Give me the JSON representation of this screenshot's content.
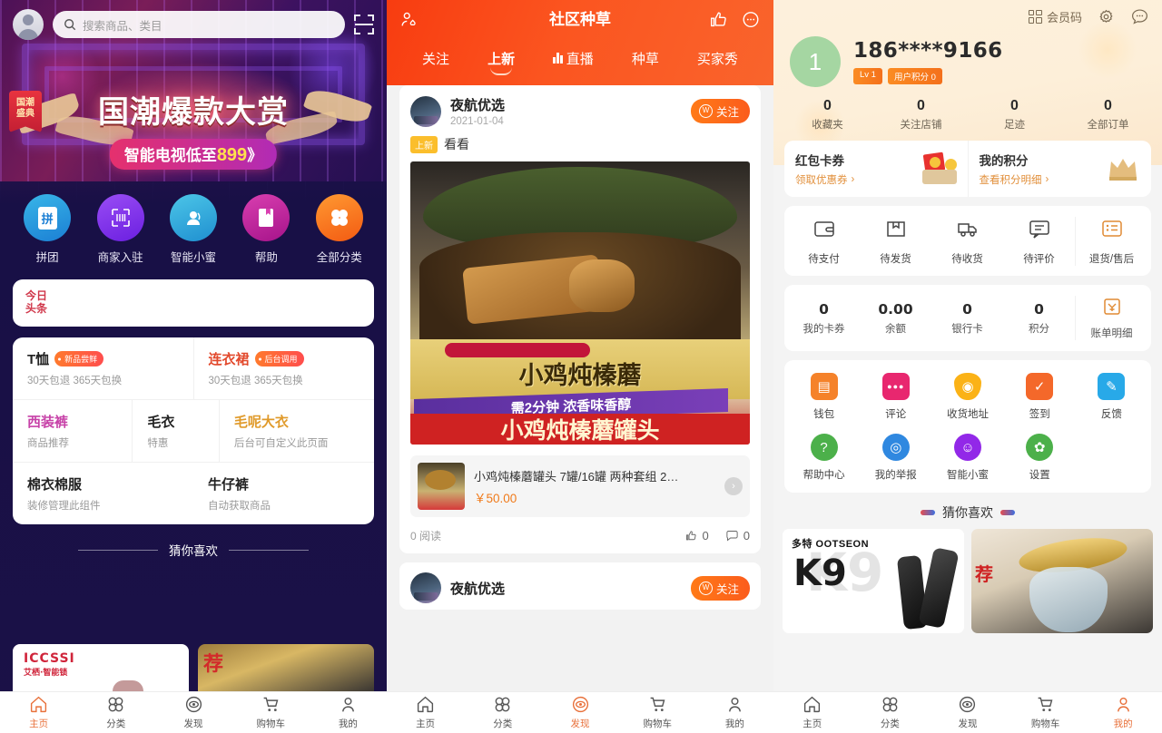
{
  "panel1": {
    "search": {
      "placeholder": "搜索商品、类目",
      "icon": "search-icon",
      "scan_icon": "scan-icon"
    },
    "banner": {
      "badge_line1": "国潮",
      "badge_line2": "盛典",
      "title": "国潮爆款大赏",
      "sub_prefix": "智能电视低至",
      "sub_price": "899",
      "sub_arrow": "》"
    },
    "categories": [
      {
        "label": "拼团",
        "glyph": "拼",
        "color": "#2aa7e0",
        "icon": "group-buy-icon"
      },
      {
        "label": "商家入驻",
        "glyph": "▦",
        "color": "#8b3ff0",
        "icon": "merchant-join-icon"
      },
      {
        "label": "智能小蜜",
        "glyph": "☏",
        "color": "#2fb0da",
        "icon": "smart-assistant-icon"
      },
      {
        "label": "帮助",
        "glyph": "▮",
        "color": "#c7249a",
        "icon": "help-icon"
      },
      {
        "label": "全部分类",
        "glyph": "❀",
        "color": "#f5791f",
        "icon": "all-categories-icon"
      }
    ],
    "news_tag_line1": "今日",
    "news_tag_line2": "头条",
    "grid": [
      [
        {
          "title": "T恤",
          "pill": "新品尝鲜",
          "sub": "30天包退 365天包换",
          "color": "#222"
        },
        {
          "title": "连衣裙",
          "pill": "后台调用",
          "sub": "30天包退 365天包换",
          "color": "#e2492c"
        }
      ],
      [
        {
          "title": "西装裤",
          "pill": "",
          "sub": "商品推荐",
          "color": "#c742a8"
        },
        {
          "title": "毛衣",
          "pill": "",
          "sub": "特惠",
          "color": "#222"
        },
        {
          "title": "毛呢大衣",
          "pill": "",
          "sub": "后台可自定义此页面",
          "color": "#e09a2a"
        }
      ],
      [
        {
          "title": "棉衣棉服",
          "pill": "",
          "sub": "装修管理此组件",
          "color": "#222"
        },
        {
          "title": "牛仔裤",
          "pill": "",
          "sub": "自动获取商品",
          "color": "#222"
        }
      ]
    ],
    "guess_title": "猜你喜欢",
    "products": [
      {
        "brand": "ICCSSI",
        "brand_sub": "艾栖·智能锁"
      },
      {
        "overlay_text": "荐"
      }
    ],
    "tabs": [
      {
        "label": "主页",
        "icon": "home-icon",
        "active": true
      },
      {
        "label": "分类",
        "icon": "category-icon",
        "active": false
      },
      {
        "label": "发现",
        "icon": "discover-icon",
        "active": false
      },
      {
        "label": "购物车",
        "icon": "cart-icon",
        "active": false
      },
      {
        "label": "我的",
        "icon": "profile-icon",
        "active": false
      }
    ]
  },
  "panel2": {
    "header": {
      "title": "社区种草",
      "left_icon": "friends-icon",
      "like_icon": "thumbs-up-icon",
      "more_icon": "chat-bubble-icon"
    },
    "tabs": [
      {
        "label": "关注",
        "active": false,
        "icon": ""
      },
      {
        "label": "上新",
        "active": true,
        "icon": ""
      },
      {
        "label": "直播",
        "active": false,
        "icon": "live-icon"
      },
      {
        "label": "种草",
        "active": false,
        "icon": ""
      },
      {
        "label": "买家秀",
        "active": false,
        "icon": ""
      }
    ],
    "posts": [
      {
        "author": "夜航优选",
        "date": "2021-01-04",
        "follow_label": "关注",
        "tag": "上新",
        "text": "看看",
        "image": {
          "brand_line": "小鸡炖榛蘑",
          "banner_line": "需2分钟 浓香味香醇",
          "bottom_line": "小鸡炖榛蘑罐头"
        },
        "product": {
          "title": "小鸡炖榛蘑罐头 7罐/16罐 两种套组 2…",
          "price": "￥50.00",
          "arrow": "›"
        },
        "read_count": "0 阅读",
        "likes": "0",
        "comments": "0"
      },
      {
        "author": "夜航优选",
        "follow_label": "关注"
      }
    ],
    "tabs_bottom": [
      {
        "label": "主页",
        "icon": "home-icon",
        "active": false
      },
      {
        "label": "分类",
        "icon": "category-icon",
        "active": false
      },
      {
        "label": "发现",
        "icon": "discover-icon",
        "active": true
      },
      {
        "label": "购物车",
        "icon": "cart-icon",
        "active": false
      },
      {
        "label": "我的",
        "icon": "profile-icon",
        "active": false
      }
    ]
  },
  "panel3": {
    "header": {
      "member_code": "会员码",
      "qr_icon": "qr-code-icon",
      "settings_icon": "gear-icon",
      "message_icon": "chat-bubble-icon"
    },
    "user": {
      "avatar_letter": "1",
      "phone": "186****9166",
      "level_badge": "Lv 1",
      "points_badge": "用户积分 0"
    },
    "stats": [
      {
        "value": "0",
        "label": "收藏夹"
      },
      {
        "value": "0",
        "label": "关注店铺"
      },
      {
        "value": "0",
        "label": "足迹"
      },
      {
        "value": "0",
        "label": "全部订单"
      }
    ],
    "coupon": {
      "left_title": "红包卡券",
      "left_sub": "领取优惠券",
      "left_icon": "red-packet-icon",
      "right_title": "我的积分",
      "right_sub": "查看积分明细",
      "right_icon": "crown-icon",
      "arrow": "›"
    },
    "orders": [
      {
        "label": "待支付",
        "icon": "wallet-icon"
      },
      {
        "label": "待发货",
        "icon": "box-icon"
      },
      {
        "label": "待收货",
        "icon": "truck-icon"
      },
      {
        "label": "待评价",
        "icon": "comment-icon"
      },
      {
        "label": "退货/售后",
        "icon": "refund-list-icon"
      }
    ],
    "wallet": [
      {
        "value": "0",
        "label": "我的卡券"
      },
      {
        "value": "0.00",
        "label": "余额"
      },
      {
        "value": "0",
        "label": "银行卡"
      },
      {
        "value": "0",
        "label": "积分"
      },
      {
        "value": "",
        "label": "账单明细",
        "icon": "bill-icon"
      }
    ],
    "grid": [
      {
        "label": "钱包",
        "icon": "wallet-cash-icon",
        "color": "#f5822a",
        "glyph": "▤"
      },
      {
        "label": "评论",
        "icon": "comment-icon",
        "color": "#e8276f",
        "glyph": "●●●"
      },
      {
        "label": "收货地址",
        "icon": "location-pin-icon",
        "color": "#fbb216",
        "glyph": "◉"
      },
      {
        "label": "签到",
        "icon": "calendar-check-icon",
        "color": "#f4682a",
        "glyph": "✓"
      },
      {
        "label": "反馈",
        "icon": "feedback-icon",
        "color": "#28a9e8",
        "glyph": "✎"
      },
      {
        "label": "帮助中心",
        "icon": "question-icon",
        "color": "#4cb04a",
        "glyph": "?"
      },
      {
        "label": "我的举报",
        "icon": "report-icon",
        "color": "#2f88e0",
        "glyph": "◎"
      },
      {
        "label": "智能小蜜",
        "icon": "smart-assistant-icon",
        "color": "#9228e8",
        "glyph": "☺"
      },
      {
        "label": "设置",
        "icon": "gear-icon",
        "color": "#4cb04a",
        "glyph": "✿"
      }
    ],
    "guess_title": "猜你喜欢",
    "products": [
      {
        "brand": "多特 OOTSEON",
        "model": "K9"
      },
      {
        "overlay_text": "荐"
      }
    ],
    "tabs": [
      {
        "label": "主页",
        "icon": "home-icon",
        "active": false
      },
      {
        "label": "分类",
        "icon": "category-icon",
        "active": false
      },
      {
        "label": "发现",
        "icon": "discover-icon",
        "active": false
      },
      {
        "label": "购物车",
        "icon": "cart-icon",
        "active": false
      },
      {
        "label": "我的",
        "icon": "profile-icon",
        "active": true
      }
    ]
  }
}
